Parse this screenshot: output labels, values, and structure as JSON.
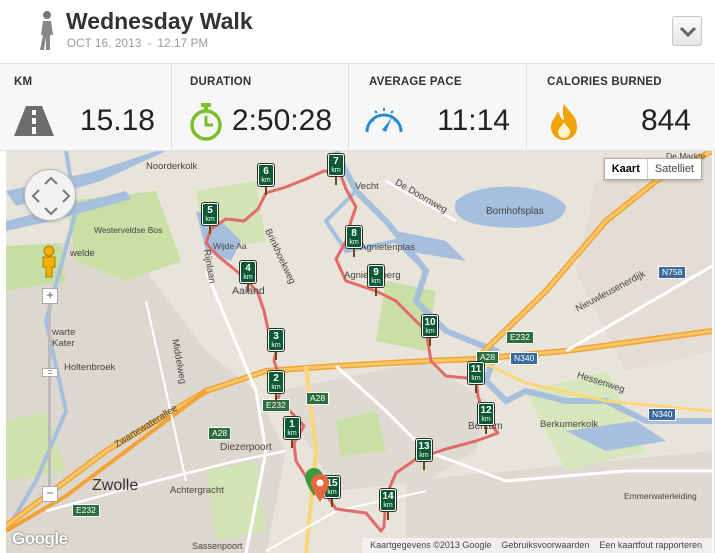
{
  "header": {
    "title": "Wednesday Walk",
    "date": "OCT 16, 2013",
    "separator": "-",
    "time": "12.17 PM"
  },
  "stats": [
    {
      "label": "KM",
      "value": "15.18",
      "icon": "road-icon"
    },
    {
      "label": "DURATION",
      "value": "2:50:28",
      "icon": "stopwatch-icon"
    },
    {
      "label": "AVERAGE PACE",
      "value": "11:14",
      "icon": "speedometer-icon"
    },
    {
      "label": "CALORIES BURNED",
      "value": "844",
      "icon": "flame-icon"
    }
  ],
  "colors": {
    "route": "#e06767",
    "marker": "#0b5a34",
    "accent_green": "#7bbf2a",
    "accent_blue": "#2a8bd4",
    "flame": "#f0a30a"
  },
  "map": {
    "type_buttons": [
      "Kaart",
      "Satelliet"
    ],
    "selected_type": "Kaart",
    "markers": [
      "1",
      "2",
      "3",
      "4",
      "5",
      "6",
      "7",
      "8",
      "9",
      "10",
      "11",
      "12",
      "13",
      "14",
      "15"
    ],
    "marker_unit": "km",
    "places": {
      "noorderkolk": "Noorderkolk",
      "westerveldse_bos": "Westerveldse Bos",
      "wijde_aa": "Wijde Aa",
      "aalanden": "Aaland",
      "vecht": "Vecht",
      "de_doornweg": "De Doornweg",
      "bomhofsplas": "Bomhofsplas",
      "agnietenplas": "Agnietenplas",
      "agnietenberg": "Agnietenberg",
      "holtenbroek": "Holtenbroek",
      "diezerpoort": "Diezerpoort",
      "zwolle": "Zwolle",
      "achtergracht": "Achtergracht",
      "berkum": "Berkum",
      "berkumerkolk": "Berkumerkolk",
      "emmerwaterleiding": "Emmerwaterleiding",
      "hessenweg": "Hessenweg",
      "nieuwleusenerdijk": "Nieuwleusenerdijk",
      "de_markte": "De Markte",
      "sassenpoort": "Sassenpoort",
      "brinkhoekweg": "Brinkhoekweg",
      "rijnlaan": "Rijnlaan",
      "middelweg": "Middelweg",
      "zwartewaterallee": "Zwartewaterallee",
      "warte_kater": "warte Kater",
      "wetevelde": "welde"
    },
    "roads": [
      "A28",
      "A28",
      "A28",
      "E232",
      "E232",
      "N340",
      "N340",
      "N758",
      "E232"
    ],
    "footer": [
      "Kaartgegevens ©2013 Google",
      "Gebruiksvoorwaarden",
      "Een kaartfout rapporteren"
    ],
    "google_logo": "Google"
  }
}
